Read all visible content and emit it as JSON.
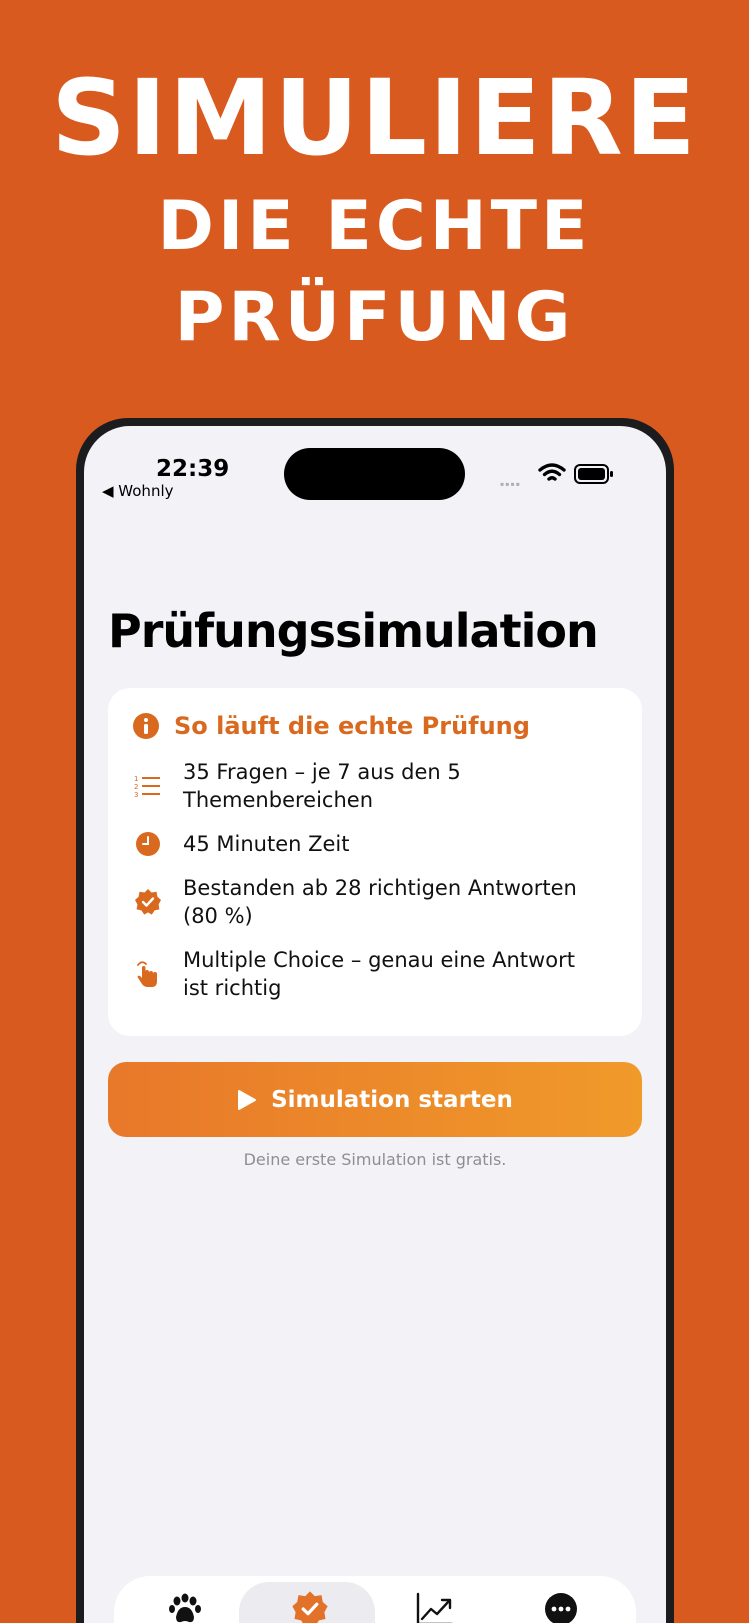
{
  "headline": {
    "line1": "SIMULIERE",
    "line2": "DIE ECHTE",
    "line3": "PRÜFUNG"
  },
  "status_bar": {
    "time": "22:39",
    "back_label": "◀ Wohnly",
    "signal": "▪▪▪▪"
  },
  "page": {
    "title": "Prüfungssimulation"
  },
  "info_card": {
    "title": "So läuft die echte Prüfung",
    "items": [
      {
        "icon": "numbered-list-icon",
        "text": "35 Fragen – je 7 aus den 5 Themenbereichen"
      },
      {
        "icon": "clock-icon",
        "text": "45 Minuten Zeit"
      },
      {
        "icon": "checkmark-seal-icon",
        "text": "Bestanden ab 28 richtigen Antworten (80 %)"
      },
      {
        "icon": "tap-hand-icon",
        "text": "Multiple Choice – genau eine Antwort ist richtig"
      }
    ]
  },
  "cta": {
    "label": "Simulation starten",
    "note": "Deine erste Simulation ist gratis."
  },
  "tabbar": {
    "selected": 1,
    "tabs": [
      {
        "icon": "paw-icon"
      },
      {
        "icon": "checkmark-seal-icon"
      },
      {
        "icon": "chart-trend-icon"
      },
      {
        "icon": "more-icon"
      }
    ]
  },
  "colors": {
    "background": "#d95a1f",
    "accent": "#d9691f",
    "cta_start": "#e8782a",
    "cta_end": "#f09a2a",
    "screen": "#f2f2f7"
  }
}
